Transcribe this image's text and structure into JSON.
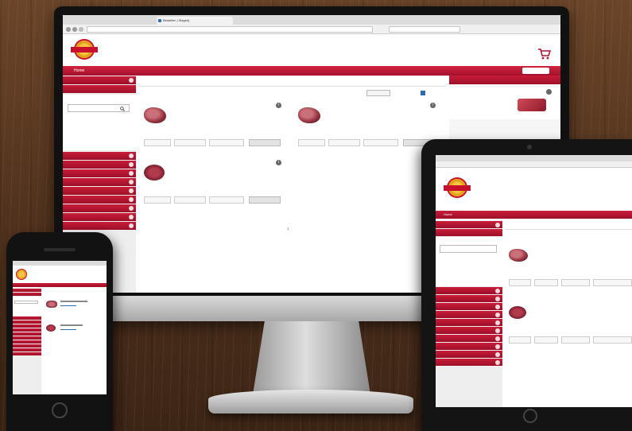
{
  "desktop": {
    "browser": {
      "tab_title": "Bestellen | Slagerij",
      "url": "",
      "search_placeholder": ""
    },
    "header": {
      "logo_text": "",
      "links": [
        "",
        ""
      ],
      "cart_label": "",
      "cart_amount": ""
    },
    "nav": {
      "items": [
        "Home",
        "",
        "",
        ""
      ],
      "right_link": "",
      "login": ""
    },
    "sidebar": {
      "top_items": [
        "",
        ""
      ],
      "search_placeholder": "",
      "search_link": "",
      "categories": [
        "",
        "",
        "",
        "",
        "",
        "",
        "",
        "",
        ""
      ]
    },
    "main": {
      "title": "",
      "sort_label": "",
      "toggle_label": "",
      "products": [
        {
          "name": "",
          "code": "",
          "rows": [
            {
              "label": "",
              "value": ""
            },
            {
              "label": "",
              "value": ""
            },
            {
              "label": "",
              "value": ""
            }
          ],
          "price": "",
          "fields": [
            "",
            "",
            ""
          ],
          "order_label": ""
        },
        {
          "name": "",
          "code": "",
          "rows": [
            {
              "label": "",
              "value": ""
            },
            {
              "label": "",
              "value": ""
            },
            {
              "label": "",
              "value": ""
            }
          ],
          "price": "",
          "fields": [
            "",
            "",
            ""
          ],
          "order_label": ""
        },
        {
          "name": "",
          "code": "",
          "rows": [
            {
              "label": "",
              "value": ""
            },
            {
              "label": "",
              "value": ""
            },
            {
              "label": "",
              "value": ""
            }
          ],
          "price": "",
          "fields": [
            "",
            "",
            ""
          ],
          "order_label": ""
        }
      ],
      "pagination": "1"
    },
    "cart_panel": {
      "title": "",
      "item": {
        "name": "",
        "rows": [
          {
            "label": "",
            "value": ""
          },
          {
            "label": "",
            "value": ""
          },
          {
            "label": "",
            "value": ""
          }
        ]
      }
    }
  },
  "tablet": {
    "nav_items": [
      "Home",
      "",
      "",
      ""
    ],
    "title": "",
    "products": [
      {
        "name": "",
        "price": ""
      },
      {
        "name": "",
        "price": ""
      }
    ],
    "sidebar_link": ""
  },
  "colors": {
    "brand_red": "#b31232",
    "nav_red": "#c81d3a",
    "price_blue": "#2d6bb5",
    "wood": "#5a3a24"
  }
}
